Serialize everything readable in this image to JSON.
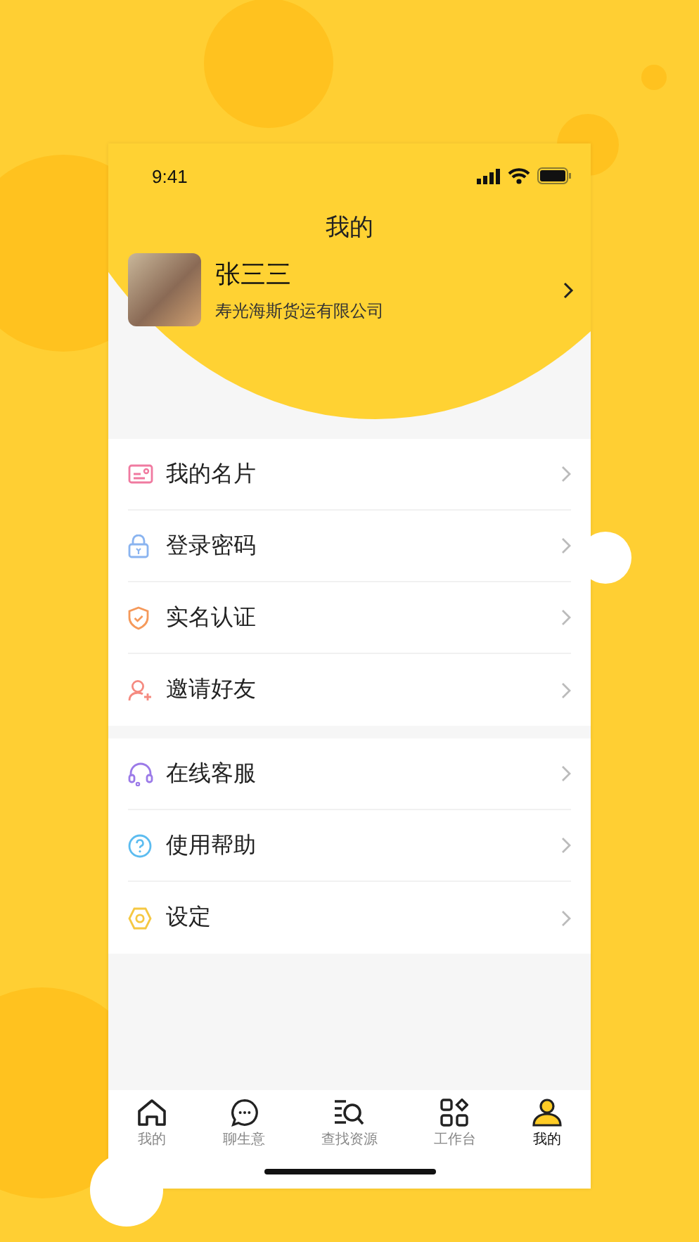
{
  "status_bar": {
    "time": "9:41"
  },
  "header": {
    "title": "我的"
  },
  "profile": {
    "name": "张三三",
    "company": "寿光海斯货运有限公司"
  },
  "menu_groups": [
    {
      "items": [
        {
          "label": "我的名片"
        },
        {
          "label": "登录密码"
        },
        {
          "label": "实名认证"
        },
        {
          "label": "邀请好友"
        }
      ]
    },
    {
      "items": [
        {
          "label": "在线客服"
        },
        {
          "label": "使用帮助"
        },
        {
          "label": "设定"
        }
      ]
    }
  ],
  "tab_bar": [
    {
      "label": "我的",
      "selected": false
    },
    {
      "label": "聊生意",
      "selected": false
    },
    {
      "label": "查找资源",
      "selected": false
    },
    {
      "label": "工作台",
      "selected": false
    },
    {
      "label": "我的",
      "selected": true
    }
  ]
}
